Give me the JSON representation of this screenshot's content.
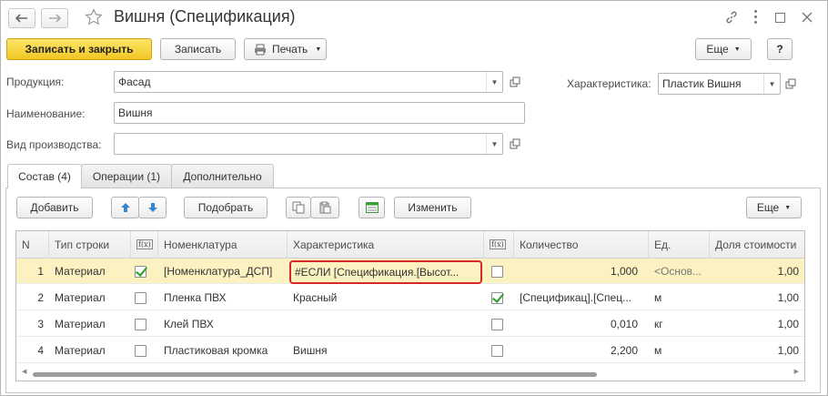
{
  "window": {
    "title": "Вишня (Спецификация)",
    "back_icon": "arrow-left-icon",
    "forward_icon": "arrow-right-icon",
    "favorite_icon": "star-icon"
  },
  "toolbar": {
    "save_close": "Записать и закрыть",
    "save": "Записать",
    "print": "Печать",
    "more": "Еще",
    "help": "?"
  },
  "form": {
    "product_label": "Продукция:",
    "product_value": "Фасад",
    "name_label": "Наименование:",
    "name_value": "Вишня",
    "production_label": "Вид производства:",
    "production_value": "",
    "characteristic_label": "Характеристика:",
    "characteristic_value": "Пластик Вишня"
  },
  "tabs": [
    {
      "label": "Состав (4)"
    },
    {
      "label": "Операции (1)"
    },
    {
      "label": "Дополнительно"
    }
  ],
  "grid_toolbar": {
    "add": "Добавить",
    "pick": "Подобрать",
    "change": "Изменить",
    "more": "Еще"
  },
  "grid": {
    "headers": [
      "N",
      "Тип строки",
      "f(x)",
      "Номенклатура",
      "Характеристика",
      "f(x)",
      "Количество",
      "Ед.",
      "Доля стоимости"
    ],
    "rows": [
      {
        "n": "1",
        "type": "Материал",
        "f1": true,
        "nomenclature": "[Номенклатура_ДСП]",
        "characteristic": "#ЕСЛИ [Спецификация.[Высот...",
        "f2": false,
        "qty": "1,000",
        "unit": "<Основ...",
        "share": "1,00"
      },
      {
        "n": "2",
        "type": "Материал",
        "f1": false,
        "nomenclature": "Пленка ПВХ",
        "characteristic": "Красный",
        "f2": true,
        "qty": "[Спецификац].[Спец...",
        "unit": "м",
        "share": "1,00"
      },
      {
        "n": "3",
        "type": "Материал",
        "f1": false,
        "nomenclature": "Клей ПВХ",
        "characteristic": "",
        "f2": false,
        "qty": "0,010",
        "unit": "кг",
        "share": "1,00"
      },
      {
        "n": "4",
        "type": "Материал",
        "f1": false,
        "nomenclature": "Пластиковая кромка",
        "characteristic": "Вишня",
        "f2": false,
        "qty": "2,200",
        "unit": "м",
        "share": "1,00"
      }
    ]
  },
  "colors": {
    "primary_button": "#f2c624",
    "selected_row": "#fcf1c0",
    "highlight_border": "#d62828",
    "check_green": "#2a9d2a"
  }
}
